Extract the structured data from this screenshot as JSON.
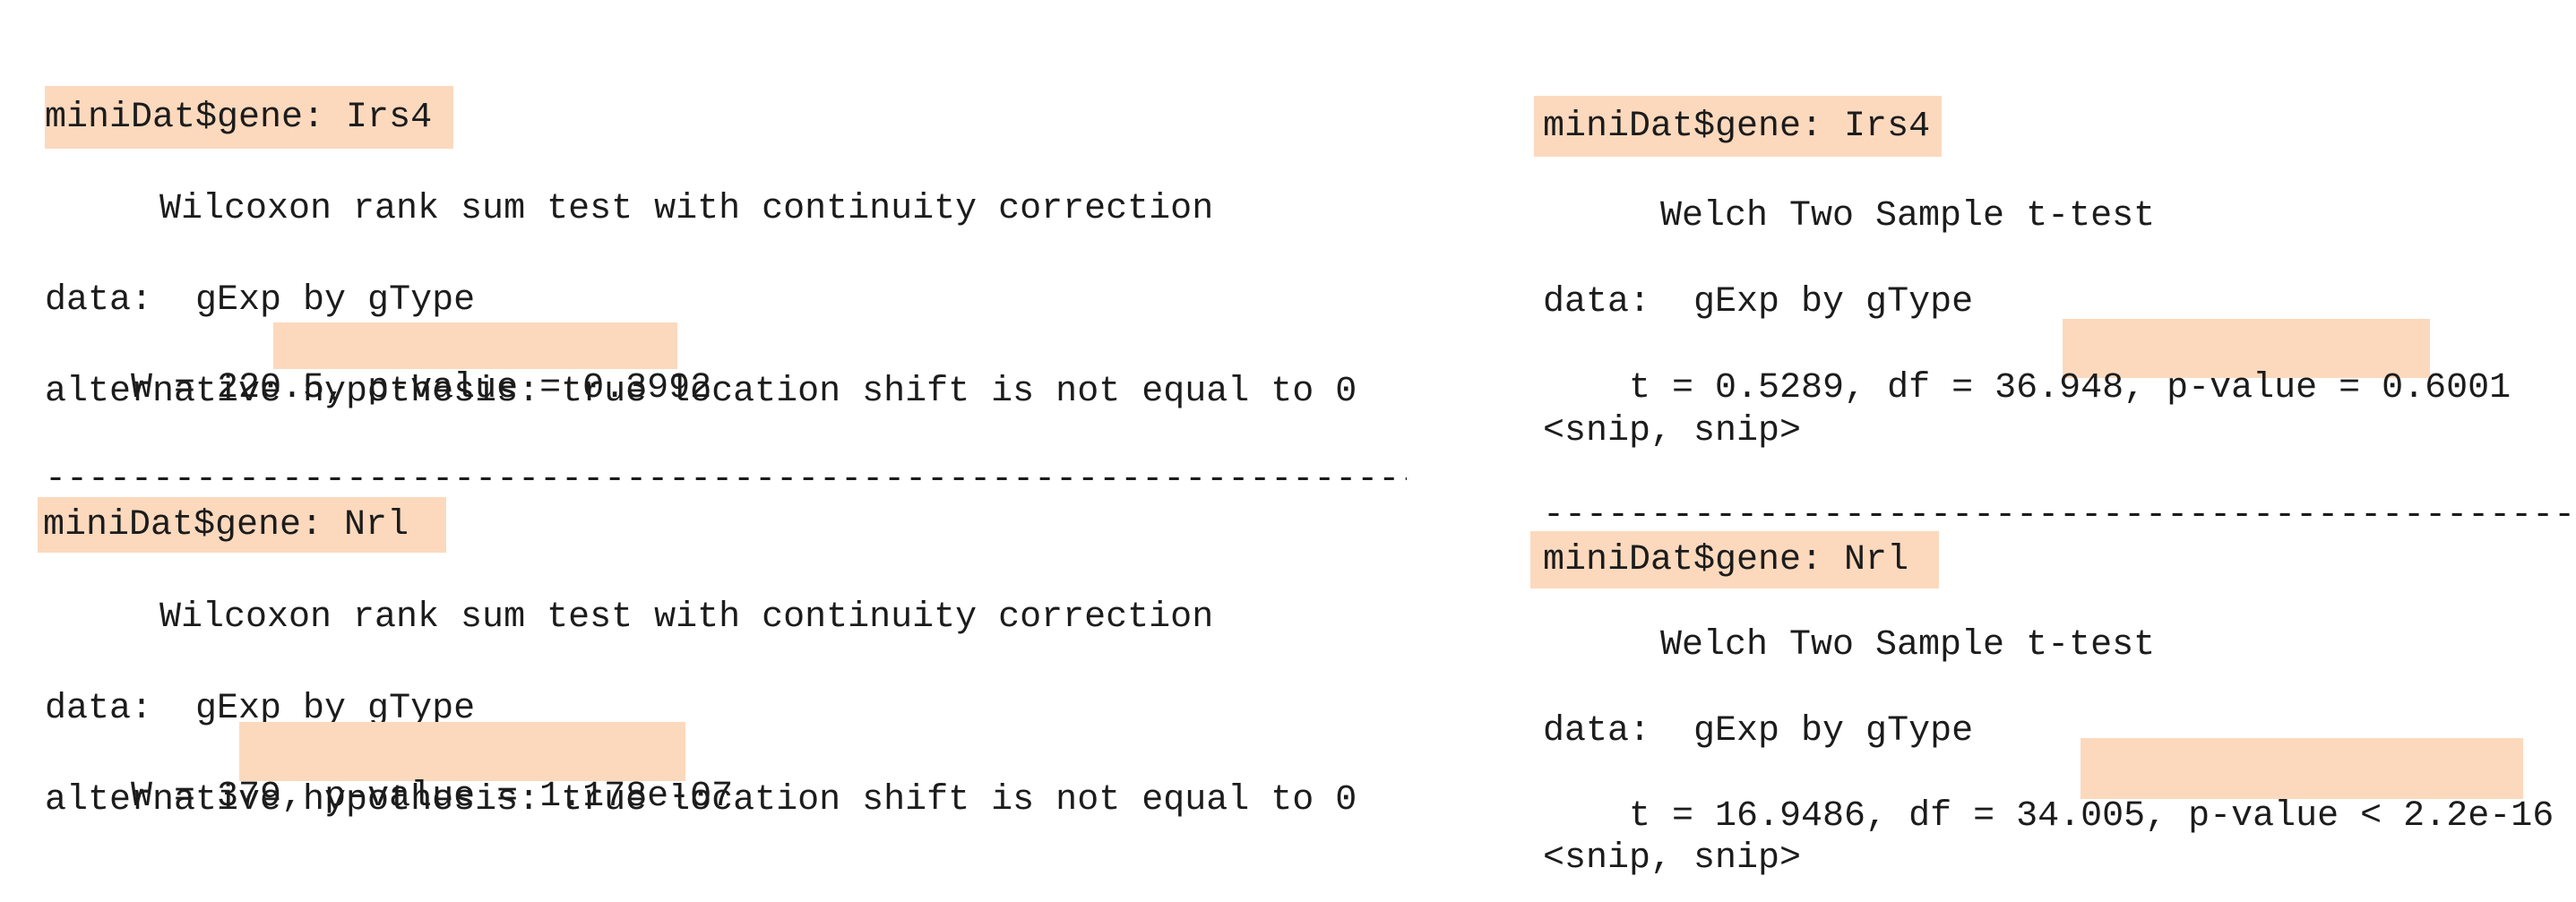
{
  "left": {
    "blocks": [
      {
        "gene_header": "miniDat$gene: Irs4",
        "test_name": "Wilcoxon rank sum test with continuity correction",
        "data_line": "data:  gExp by gType",
        "stat_prefix": "W = 220.5,",
        "p_value": "p-value = 0.3992",
        "alt_hypothesis": "alternative hypothesis: true location shift is not equal to 0"
      },
      {
        "gene_header": "miniDat$gene: Nrl",
        "test_name": "Wilcoxon rank sum test with continuity correction",
        "data_line": "data:  gExp by gType",
        "stat_prefix": "W = 379,",
        "p_value": "p-value = 1.178e-07",
        "alt_hypothesis": "alternative hypothesis: true location shift is not equal to 0"
      }
    ],
    "separator": "--------------------------------------------------------------------------------"
  },
  "right": {
    "blocks": [
      {
        "gene_header": "miniDat$gene: Irs4",
        "test_name": "Welch Two Sample t-test",
        "data_line": "data:  gExp by gType",
        "stat_prefix": "t = 0.5289, df = 36.948,",
        "p_value": "p-value = 0.6001",
        "snip": "<snip, snip>"
      },
      {
        "gene_header": "miniDat$gene: Nrl",
        "test_name": "Welch Two Sample t-test",
        "data_line": "data:  gExp by gType",
        "stat_prefix": "t = 16.9486, df = 34.005,",
        "p_value": "p-value < 2.2e-16",
        "snip": "<snip, snip>"
      }
    ],
    "separator": "--------------------------------------------------------------------------------"
  },
  "colors": {
    "highlight": "#fcd9bd",
    "text": "#1c1c1c",
    "background": "#ffffff"
  }
}
